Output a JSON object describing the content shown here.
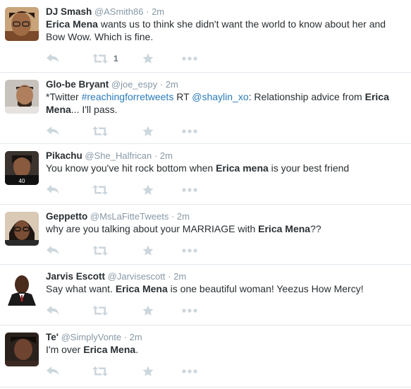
{
  "colors": {
    "link": "#2b7bb9",
    "muted": "#8899a6",
    "icon": "#ccd6dd",
    "text": "#292f33"
  },
  "icons": [
    "reply-icon",
    "retweet-icon",
    "favorite-icon",
    "more-icon"
  ],
  "tweets": [
    {
      "name": "DJ Smash",
      "handle": "@ASmith86",
      "sep": "·",
      "time": "2m",
      "parts": [
        {
          "t": "Erica Mena",
          "b": true
        },
        {
          "t": " wants us to think she didn't want the world to know about her and Bow Wow. Which is fine."
        }
      ],
      "retweets": "1"
    },
    {
      "name": "Glo-be Bryant",
      "handle": "@joe_espy",
      "sep": "·",
      "time": "2m",
      "parts": [
        {
          "t": "*Twitter "
        },
        {
          "t": "#reachingforretweets",
          "link": true
        },
        {
          "t": " RT "
        },
        {
          "t": "@shaylin_xo",
          "link": true
        },
        {
          "t": ": Relationship advice from "
        },
        {
          "t": "Erica Mena",
          "b": true
        },
        {
          "t": "... I'll pass."
        }
      ],
      "retweets": ""
    },
    {
      "name": "Pikachu",
      "handle": "@She_Halfrican",
      "sep": "·",
      "time": "2m",
      "parts": [
        {
          "t": "You know you've hit rock bottom when "
        },
        {
          "t": "Erica mena",
          "b": true
        },
        {
          "t": " is your best friend"
        }
      ],
      "retweets": ""
    },
    {
      "name": "Geppetto",
      "handle": "@MsLaFitteTweets",
      "sep": "·",
      "time": "2m",
      "parts": [
        {
          "t": "why are you talking about your MARRIAGE with "
        },
        {
          "t": "Erica Mena",
          "b": true
        },
        {
          "t": "??"
        }
      ],
      "retweets": ""
    },
    {
      "name": "Jarvis Escott",
      "handle": "@Jarvisescott",
      "sep": "·",
      "time": "2m",
      "parts": [
        {
          "t": "Say what want. "
        },
        {
          "t": "Erica Mena",
          "b": true
        },
        {
          "t": " is one beautiful woman! Yeezus How Mercy!"
        }
      ],
      "retweets": ""
    },
    {
      "name": "Te'",
      "handle": "@SimplyVonte",
      "sep": "·",
      "time": "2m",
      "parts": [
        {
          "t": "I'm over "
        },
        {
          "t": "Erica Mena",
          "b": true
        },
        {
          "t": "."
        }
      ],
      "retweets": ""
    }
  ]
}
